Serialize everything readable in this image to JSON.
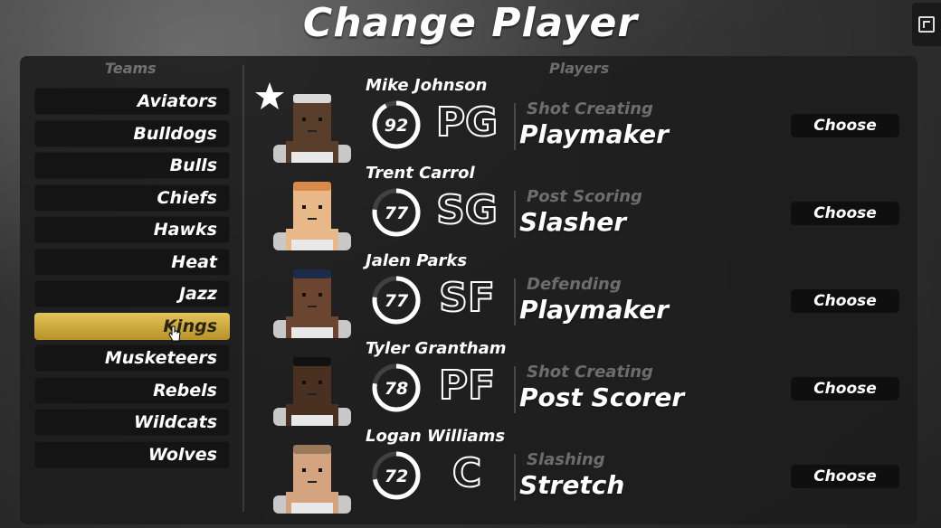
{
  "title": "Change Player",
  "teams_header": "Teams",
  "players_header": "Players",
  "colors": {
    "accent": "#d4b13f",
    "ring": "#ffffff",
    "button_bg": "#0f0f0f"
  },
  "teams": [
    "Aviators",
    "Bulldogs",
    "Bulls",
    "Chiefs",
    "Hawks",
    "Heat",
    "Jazz",
    "Kings",
    "Musketeers",
    "Rebels",
    "Wildcats",
    "Wolves"
  ],
  "selected_team": "Kings",
  "players": [
    {
      "name": "Mike Johnson",
      "rating": "92",
      "rating_value": 92,
      "position": "PG",
      "subtitle": "Shot Creating",
      "archetype": "Playmaker",
      "button": "Choose",
      "favorite": true,
      "skin": "#5a3e2c",
      "hair": "#d9d9d9"
    },
    {
      "name": "Trent Carrol",
      "rating": "77",
      "rating_value": 77,
      "position": "SG",
      "subtitle": "Post Scoring",
      "archetype": "Slasher",
      "button": "Choose",
      "favorite": false,
      "skin": "#e8b888",
      "hair": "#d98a4a"
    },
    {
      "name": "Jalen Parks",
      "rating": "77",
      "rating_value": 77,
      "position": "SF",
      "subtitle": "Defending",
      "archetype": "Playmaker",
      "button": "Choose",
      "favorite": false,
      "skin": "#6b4530",
      "hair": "#1c2b4a"
    },
    {
      "name": "Tyler Grantham",
      "rating": "78",
      "rating_value": 78,
      "position": "PF",
      "subtitle": "Shot Creating",
      "archetype": "Post Scorer",
      "button": "Choose",
      "favorite": false,
      "skin": "#4a3020",
      "hair": "#111111"
    },
    {
      "name": "Logan Williams",
      "rating": "72",
      "rating_value": 72,
      "position": "C",
      "subtitle": "Slashing",
      "archetype": "Stretch",
      "button": "Choose",
      "favorite": false,
      "skin": "#d4a380",
      "hair": "#9a7a5a"
    }
  ]
}
